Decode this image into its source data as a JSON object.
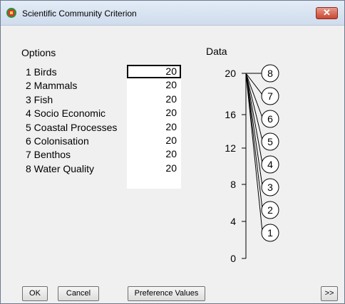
{
  "window": {
    "title": "Scientific Community Criterion"
  },
  "options": {
    "title": "Options",
    "items": [
      {
        "label": "1 Birds",
        "value": "20"
      },
      {
        "label": "2 Mammals",
        "value": "20"
      },
      {
        "label": "3 Fish",
        "value": "20"
      },
      {
        "label": "4 Socio Economic",
        "value": "20"
      },
      {
        "label": "5 Coastal Processes",
        "value": "20"
      },
      {
        "label": "6 Colonisation",
        "value": "20"
      },
      {
        "label": "7 Benthos",
        "value": "20"
      },
      {
        "label": "8 Water Quality",
        "value": "20"
      }
    ]
  },
  "data_panel": {
    "title": "Data",
    "ticks": [
      "20",
      "16",
      "12",
      "8",
      "4",
      "0"
    ],
    "markers": [
      "8",
      "7",
      "6",
      "5",
      "4",
      "3",
      "2",
      "1"
    ]
  },
  "buttons": {
    "ok": "OK",
    "cancel": "Cancel",
    "preference": "Preference Values",
    "next": ">>"
  }
}
